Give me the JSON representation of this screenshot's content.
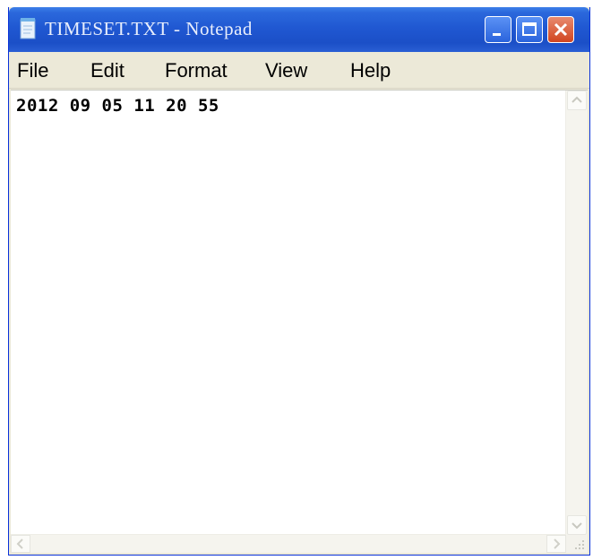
{
  "window": {
    "title": "TIMESET.TXT - Notepad"
  },
  "titlebar": {
    "icon": "notepad-icon",
    "buttons": [
      "minimize-icon",
      "maximize-icon",
      "close-icon"
    ]
  },
  "menu": {
    "file": "File",
    "edit": "Edit",
    "format": "Format",
    "view": "View",
    "help": "Help"
  },
  "document": {
    "content": "2012 09 05 11 20 55"
  },
  "colors": {
    "titlebar": "#2058d2",
    "close_button": "#d1451f",
    "menubar": "#ece9d8",
    "editor_bg": "#ffffff"
  }
}
